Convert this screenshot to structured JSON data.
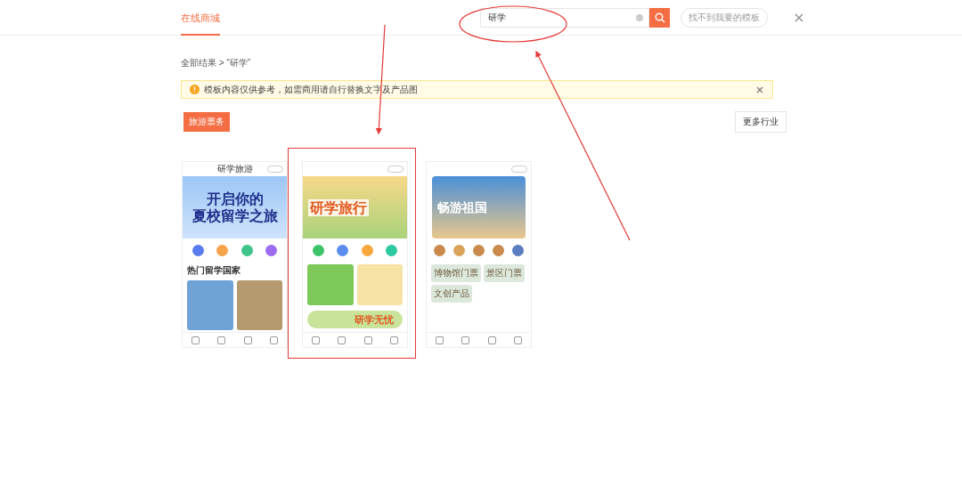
{
  "header": {
    "tab": {
      "label": "在线商城",
      "selected": true
    },
    "search": {
      "value": "研学"
    },
    "help_button": "找不到我要的模板"
  },
  "breadcrumb": "全部结果 > “研学”",
  "notice": "模板内容仅供参考，如需商用请自行替换文字及产品图",
  "category_button": "旅游票务",
  "more_button": "更多行业",
  "templates": [
    {
      "kind": "study-abroad",
      "title": "研学旅游",
      "headline": [
        "开启你的",
        "夏校留学之旅"
      ],
      "section": "热门留学国家",
      "highlighted": false
    },
    {
      "kind": "study-tour",
      "headline": [
        "研学旅行"
      ],
      "banner": "研学无忧",
      "highlighted": true
    },
    {
      "kind": "travel",
      "headline": [
        "畅游祖国"
      ],
      "tiles": [
        "博物馆门票",
        "景区门票",
        "文创产品"
      ],
      "highlighted": false
    }
  ]
}
